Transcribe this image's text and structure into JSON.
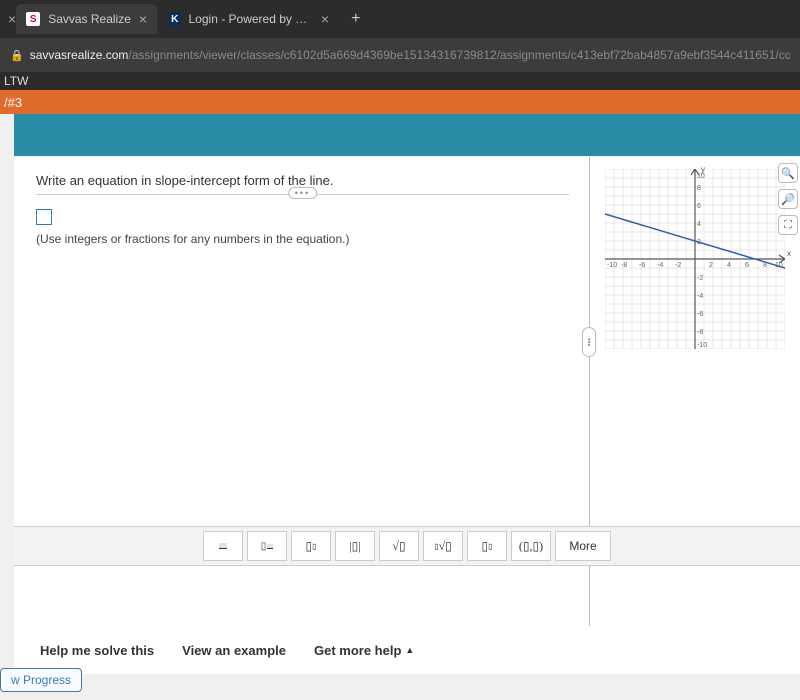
{
  "browser": {
    "tabs": [
      {
        "title": "Savvas Realize",
        "active": true
      },
      {
        "title": "Login - Powered by Skyward",
        "active": false
      }
    ],
    "url_host": "savvasrealize.com",
    "url_path": "/assignments/viewer/classes/c6102d5a669d4369be15134316739812/assignments/c413ebf72bab4857a9ebf3544c411651/conten"
  },
  "header": {
    "crumb_dark": "LTW",
    "crumb_orange": "/#3"
  },
  "question": {
    "prompt": "Write an equation in slope-intercept form of the line.",
    "hint": "(Use integers or fractions for any numbers in the equation.)"
  },
  "chart_data": {
    "type": "line",
    "title": "",
    "xlabel": "x",
    "ylabel": "y",
    "xlim": [
      -10,
      10
    ],
    "ylim": [
      -10,
      10
    ],
    "x_ticks": [
      -10,
      -8,
      -6,
      -4,
      -2,
      2,
      4,
      6,
      8,
      10
    ],
    "y_ticks": [
      -10,
      -8,
      -6,
      -4,
      -2,
      2,
      4,
      6,
      8,
      10
    ],
    "series": [
      {
        "name": "line",
        "points": [
          [
            -10,
            5
          ],
          [
            10,
            -1
          ]
        ]
      }
    ]
  },
  "palette": {
    "buttons": [
      "frac",
      "mixed",
      "exp",
      "abs",
      "sqrt",
      "nroot",
      "sub",
      "coord"
    ],
    "more": "More"
  },
  "help": {
    "solve": "Help me solve this",
    "example": "View an example",
    "more": "Get more help"
  },
  "progress_label": "w Progress"
}
